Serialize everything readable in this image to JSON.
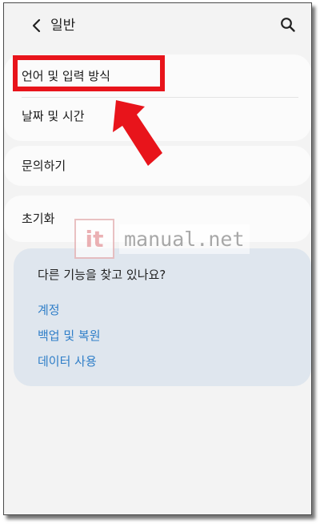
{
  "header": {
    "title": "일반",
    "back_icon": "chevron-left-icon",
    "search_icon": "search-icon"
  },
  "menu": {
    "language_input": "언어 및 입력 방식",
    "date_time": "날짜 및 시간",
    "inquiry": "문의하기",
    "reset": "초기화"
  },
  "suggestions": {
    "question": "다른 기능을 찾고 있나요?",
    "links": [
      "계정",
      "백업 및 복원",
      "데이터 사용"
    ]
  },
  "watermark": {
    "logo": "it",
    "text": "manual.net"
  },
  "colors": {
    "highlight": "#e8141b",
    "link": "#2f7ec8",
    "background": "#f3f3f3",
    "suggest_bg": "#dfe6ee"
  }
}
